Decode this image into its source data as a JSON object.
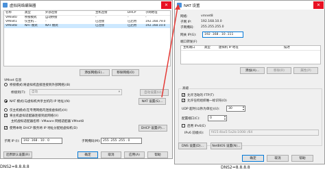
{
  "left": {
    "title": "虚拟网络编辑器",
    "headers": [
      "名称",
      "类型",
      "外部连接",
      "主机连接",
      "DHCP",
      "子网地址"
    ],
    "rows": [
      [
        "VMnet0",
        "桥接模式",
        "自动桥接",
        "-",
        "-",
        "-"
      ],
      [
        "VMnet1",
        "仅主机...",
        "-",
        "已连接",
        "已启用",
        "192.168.79.0"
      ],
      [
        "VMnet8",
        "NAT 模式",
        "NAT 模式",
        "已连接",
        "已启用",
        "192.168.10.0"
      ]
    ],
    "add_network": "添加网络(E)...",
    "remove_network": "移除网络(O)",
    "info_title": "VMnet 信息",
    "bridged_label": "桥接模式(将虚拟机直接连接到外部网络)(B)",
    "bridged_to_label": "桥接到(T):",
    "bridged_to_value": "自动",
    "auto_settings": "自动设置(U)...",
    "nat_label": "NAT 模式(与虚拟机共享主机的 IP 地址)(N)",
    "nat_settings": "NAT 设置(S)...",
    "hostonly_label": "仅主机模式(在专用网络内连接虚拟机)(H)",
    "connect_adapter_label": "将主机虚拟适配器连接到此网络(V)",
    "adapter_name_label": "主机虚拟适配器名称: VMware 网络适配器 VMnet8",
    "dhcp_label": "使用本地 DHCP 服务将 IP 地址分配给虚拟机(D)",
    "dhcp_settings": "DHCP 设置(P)...",
    "subnet_ip_label": "子网 IP (I):",
    "subnet_ip_value": "192 .168 . 10 . 0",
    "subnet_mask_label": "子网掩码(M):",
    "subnet_mask_value": "255 .255 .255 . 0",
    "restore_defaults": "还原默认设置(R)",
    "ok": "确定",
    "cancel": "取消",
    "apply": "应用(A)",
    "help": "帮助"
  },
  "right": {
    "title": "NAT 设置",
    "network_label": "网络:",
    "network_value": "vmnet8",
    "subnet_ip_label": "子网 IP:",
    "subnet_ip_value": "192.168.10.0",
    "subnet_mask_label": "子网掩码:",
    "subnet_mask_value": "255.255.255.0",
    "gateway_label": "网关 IP(G):",
    "gateway_value": "192 .168 . 10 .111",
    "port_forward_title": "端口转发(F)",
    "pf_headers": [
      "主机端口",
      "类型",
      "虚拟机 IP 地址",
      "描述"
    ],
    "add": "添加(A)...",
    "remove": "移除(R)",
    "properties": "属性(P)",
    "advanced_title": "高级",
    "allow_ftp": "允许活动的 FTP(T)",
    "allow_any_oui": "允许任何组织唯一标识符(O)",
    "udp_timeout_label": "UDP 超时(以秒为单位)(U):",
    "udp_timeout_value": "30",
    "config_port_label": "配置端口(C):",
    "config_port_value": "0",
    "enable_ipv6": "启用 IPv6(E)",
    "ipv6_prefix_label": "IPv6 前缀(6):",
    "ipv6_prefix_value": "fd15:4ba5:5a2b:1008::/64",
    "dns_settings": "DNS 设置(D)...",
    "netbios_settings": "NetBIOS 设置(N)...",
    "ok": "确定",
    "cancel": "取消",
    "help": "帮助"
  },
  "footer": {
    "left_text": "DNS2=8.8.8.8",
    "right_text": "DNS2=8.8.8.8"
  },
  "colors": {
    "arrow": "#e53935",
    "selection": "#cce8ff",
    "accent": "#0078d7"
  }
}
